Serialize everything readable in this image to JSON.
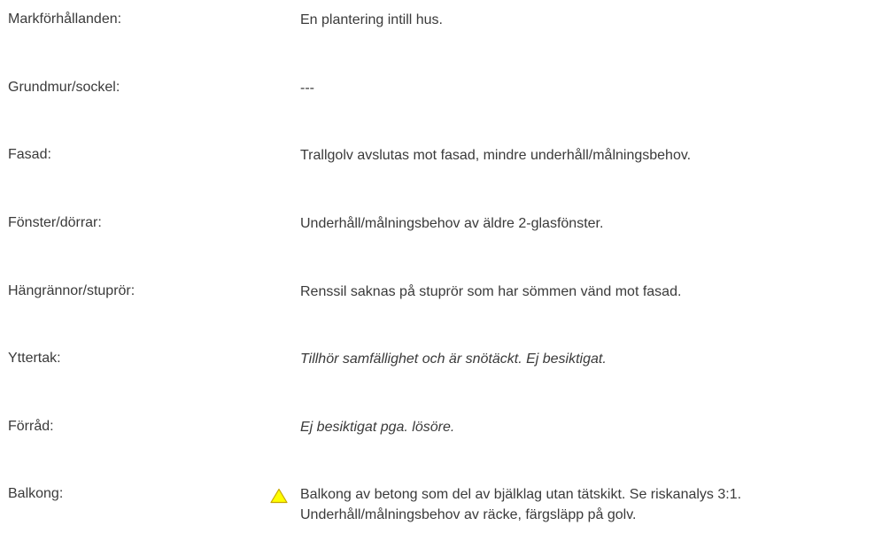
{
  "rows": [
    {
      "label": "Markförhållanden:",
      "value": "En plantering intill hus.",
      "italic": false,
      "warning": false
    },
    {
      "label": "Grundmur/sockel:",
      "value": "---",
      "italic": false,
      "warning": false
    },
    {
      "label": "Fasad:",
      "value": "Trallgolv avslutas mot fasad, mindre underhåll/målningsbehov.",
      "italic": false,
      "warning": false
    },
    {
      "label": "Fönster/dörrar:",
      "value": "Underhåll/målningsbehov av äldre 2-glasfönster.",
      "italic": false,
      "warning": false
    },
    {
      "label": "Hängrännor/stuprör:",
      "value": "Renssil saknas på stuprör som har sömmen vänd mot fasad.",
      "italic": false,
      "warning": false
    },
    {
      "label": "Yttertak:",
      "value": "Tillhör samfällighet och är snötäckt. Ej besiktigat.",
      "italic": true,
      "warning": false
    },
    {
      "label": "Förråd:",
      "value": "Ej besiktigat pga. lösöre.",
      "italic": true,
      "warning": false
    },
    {
      "label": "Balkong:",
      "value": "Balkong av betong som del av bjälklag utan tätskikt. Se riskanalys 3:1. Underhåll/målningsbehov av räcke, färgsläpp på golv.",
      "italic": false,
      "warning": true,
      "warning_icon": "warning-triangle-icon"
    }
  ],
  "colors": {
    "text": "#3a3a3a",
    "warning_fill": "#ffff00",
    "warning_stroke": "#c8a600"
  }
}
